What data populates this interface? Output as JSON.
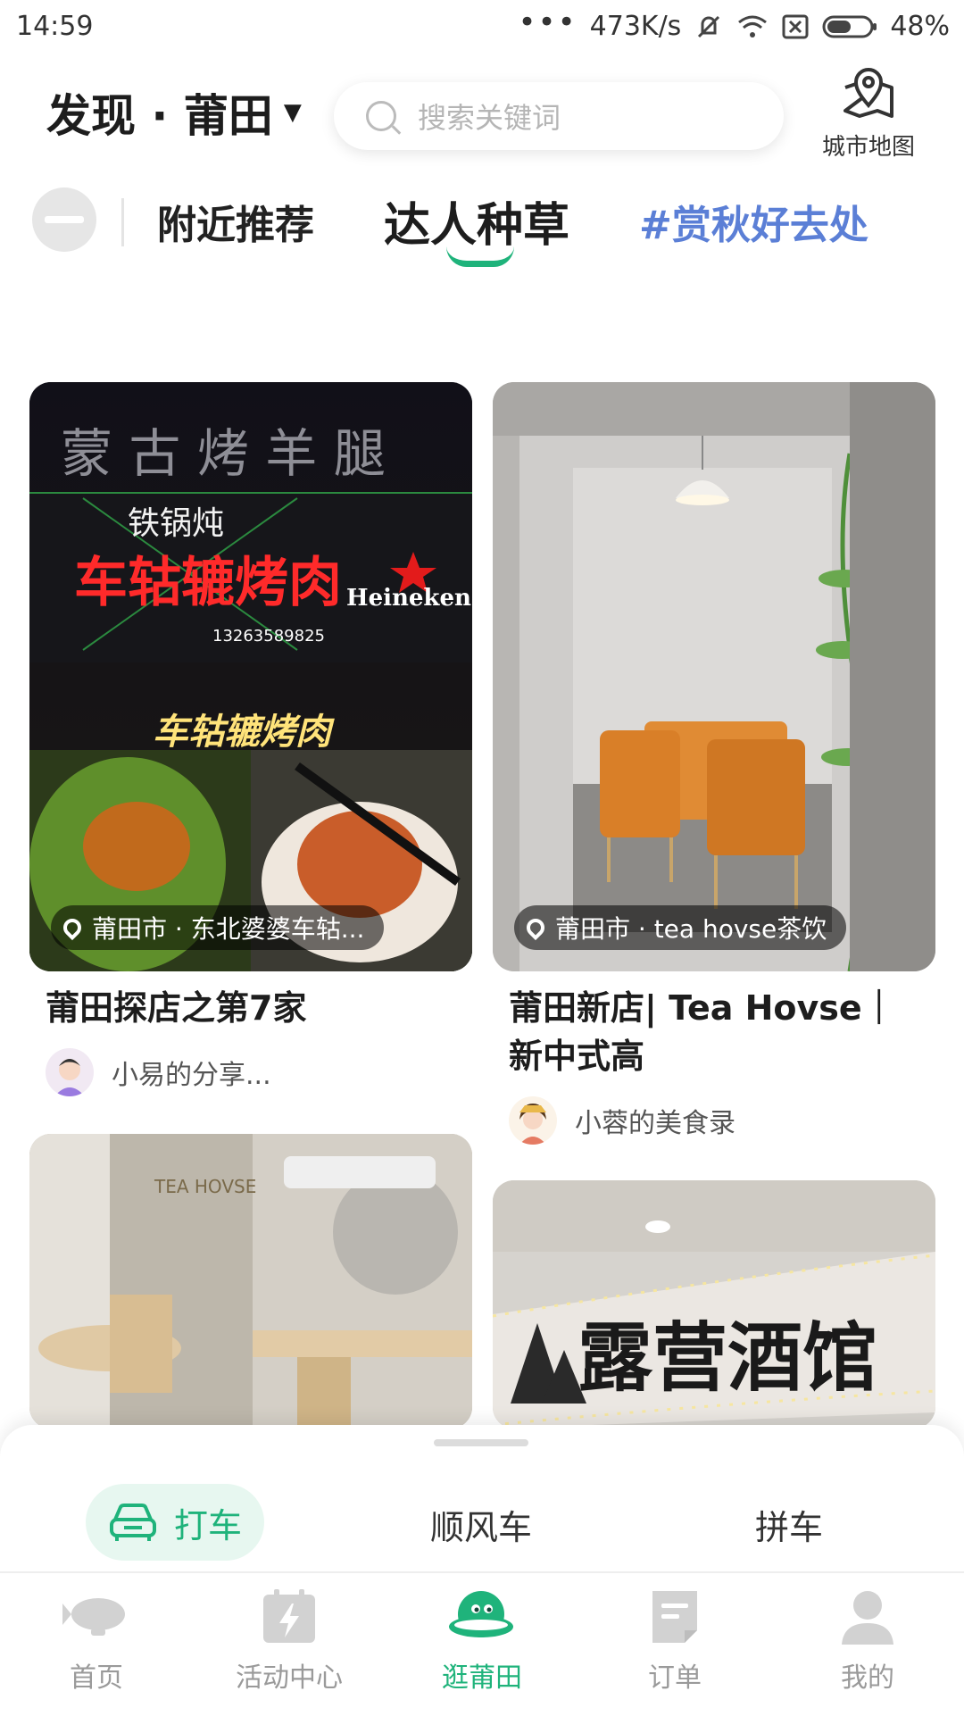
{
  "status_bar": {
    "time": "14:59",
    "network_speed": "473K/s",
    "battery": "48%"
  },
  "header": {
    "city_title": "发现 · 莆田",
    "search_placeholder": "搜索关键词",
    "map_label": "城市地图"
  },
  "tabs": {
    "nearby": "附近推荐",
    "daren": "达人种草",
    "topic": "#赏秋好去处"
  },
  "cards": [
    {
      "image_text_top": "蒙 古 烤 羊 腿",
      "image_text_sign": "车轱辘烤肉",
      "image_text_sub": "铁锅炖",
      "image_text_brand": "Heineken",
      "image_text_caption": "车轱辘烤肉",
      "image_text_phone": "13263589825",
      "location": "莆田市 · 东北婆婆车轱...",
      "title": "莆田探店之第7家",
      "author": "小易的分享..."
    },
    {
      "location": "莆田市 · tea hovse茶饮",
      "title": "莆田新店| Tea Hovse｜新中式高",
      "author": "小蓉的美食录"
    },
    {
      "image_text": "TEA HOVSE"
    },
    {
      "image_text": "露营酒馆"
    }
  ],
  "ride_bar": {
    "taxi": "打车",
    "hitch": "顺风车",
    "carpool": "拼车"
  },
  "bottom_nav": [
    {
      "label": "首页",
      "icon": "home-blimp-icon"
    },
    {
      "label": "活动中心",
      "icon": "activity-calendar-icon"
    },
    {
      "label": "逛莆田",
      "icon": "explore-planet-icon",
      "active": true
    },
    {
      "label": "订单",
      "icon": "order-document-icon"
    },
    {
      "label": "我的",
      "icon": "profile-person-icon"
    }
  ],
  "colors": {
    "accent": "#1fb37b",
    "topic": "#5b7fd6"
  }
}
